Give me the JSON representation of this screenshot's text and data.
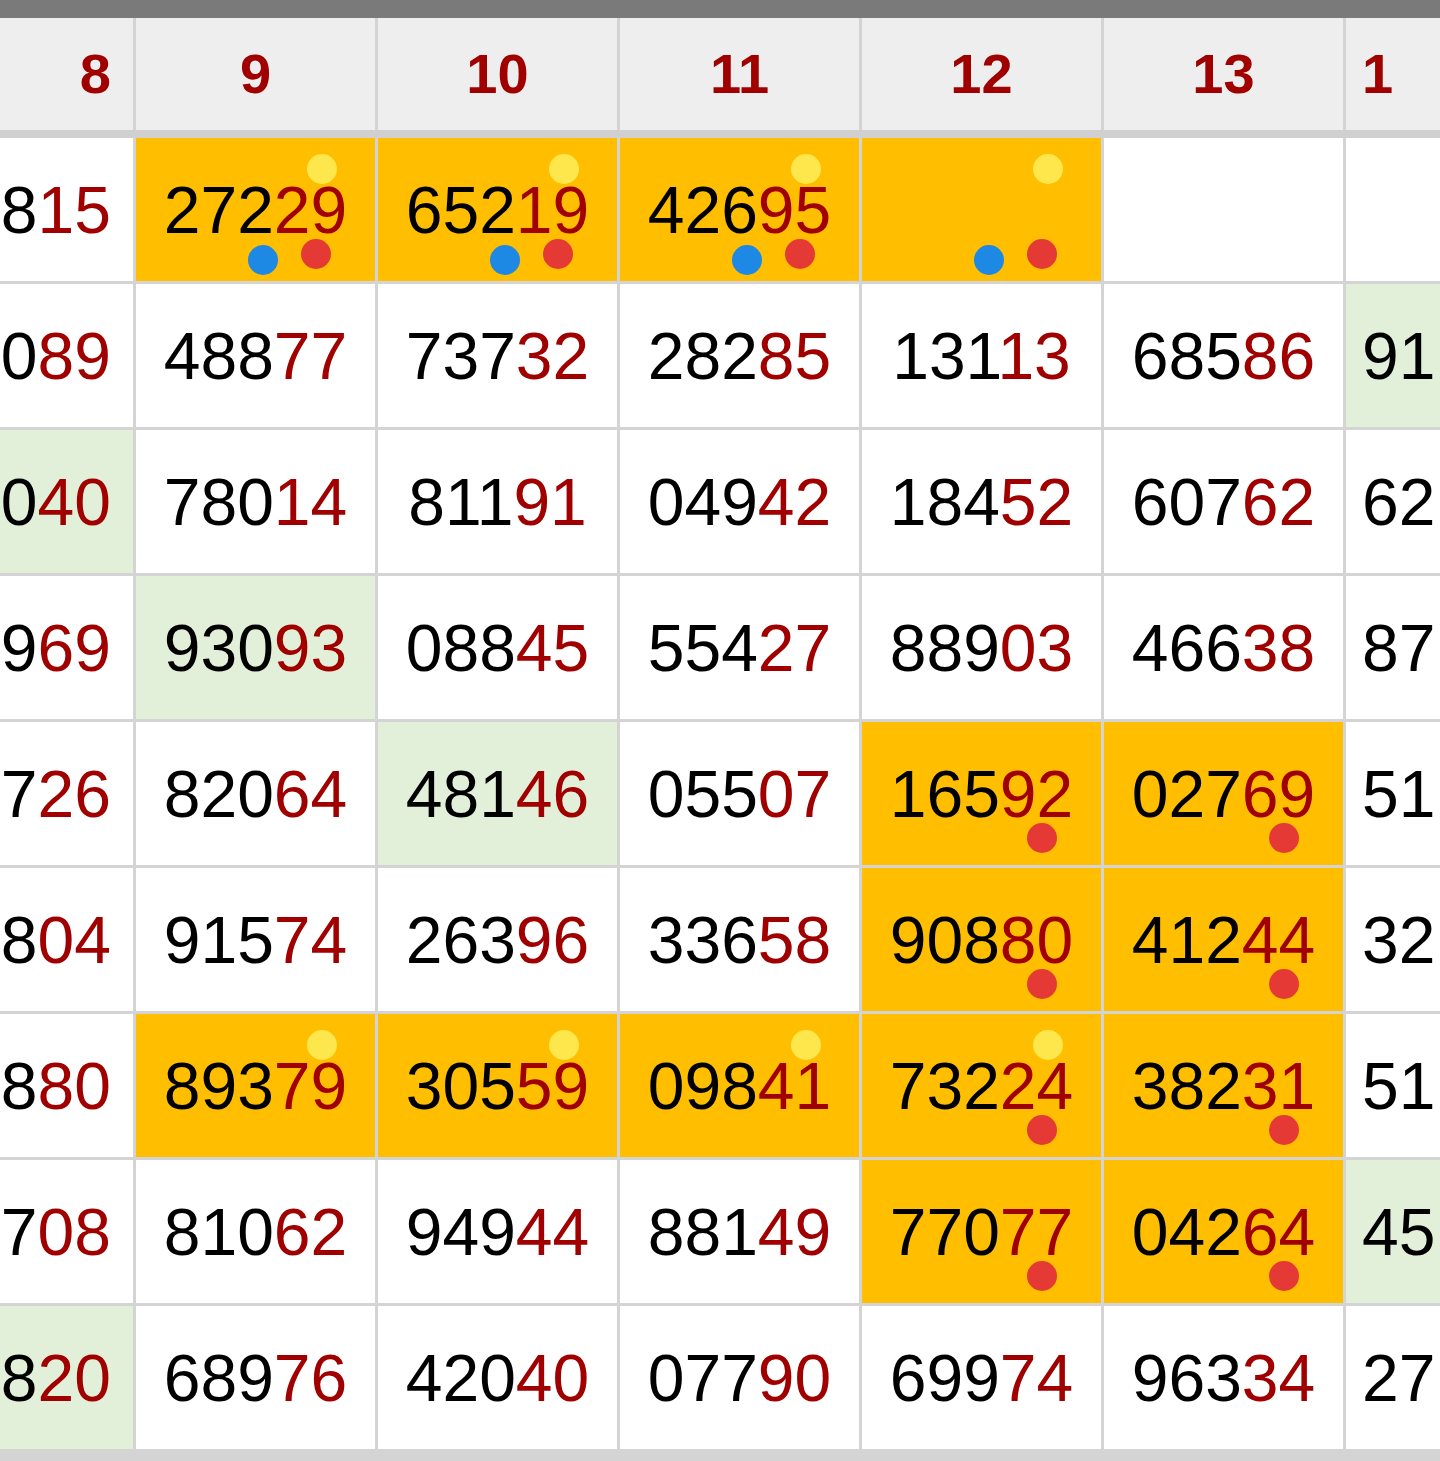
{
  "columns": [
    {
      "label": "8"
    },
    {
      "label": "9"
    },
    {
      "label": "10"
    },
    {
      "label": "11"
    },
    {
      "label": "12"
    },
    {
      "label": "13"
    },
    {
      "label": "1"
    }
  ],
  "rows": [
    {
      "cells": [
        {
          "lead": "8",
          "tail": "15",
          "color": "#ffffff"
        },
        {
          "lead": "272",
          "tail": "29",
          "color": "#ffbf00",
          "dots": [
            {
              "kind": "top",
              "color": "#fde74c"
            },
            {
              "kind": "left",
              "color": "#1e88e5"
            },
            {
              "kind": "right",
              "color": "#e53935"
            }
          ]
        },
        {
          "lead": "652",
          "tail": "19",
          "color": "#ffbf00",
          "dots": [
            {
              "kind": "top",
              "color": "#fde74c"
            },
            {
              "kind": "left",
              "color": "#1e88e5"
            },
            {
              "kind": "right",
              "color": "#e53935"
            }
          ]
        },
        {
          "lead": "426",
          "tail": "95",
          "color": "#ffbf00",
          "dots": [
            {
              "kind": "top",
              "color": "#fde74c"
            },
            {
              "kind": "left",
              "color": "#1e88e5"
            },
            {
              "kind": "right",
              "color": "#e53935"
            }
          ]
        },
        {
          "color": "#ffbf00",
          "dots": [
            {
              "kind": "top",
              "color": "#fde74c"
            },
            {
              "kind": "left",
              "color": "#1e88e5"
            },
            {
              "kind": "right",
              "color": "#e53935"
            }
          ]
        },
        {
          "color": "#ffffff"
        },
        {
          "color": "#ffffff"
        }
      ]
    },
    {
      "cells": [
        {
          "lead": "0",
          "tail": "89",
          "color": "#ffffff"
        },
        {
          "lead": "488",
          "tail": "77",
          "color": "#ffffff"
        },
        {
          "lead": "737",
          "tail": "32",
          "color": "#ffffff"
        },
        {
          "lead": "282",
          "tail": "85",
          "color": "#ffffff"
        },
        {
          "lead": "131",
          "tail": "13",
          "color": "#ffffff"
        },
        {
          "lead": "685",
          "tail": "86",
          "color": "#ffffff"
        },
        {
          "lead": "91",
          "color": "#e2f0da"
        }
      ]
    },
    {
      "cells": [
        {
          "lead": "0",
          "tail": "40",
          "color": "#e2f0da"
        },
        {
          "lead": "780",
          "tail": "14",
          "color": "#ffffff"
        },
        {
          "lead": "811",
          "tail": "91",
          "color": "#ffffff"
        },
        {
          "lead": "049",
          "tail": "42",
          "color": "#ffffff"
        },
        {
          "lead": "184",
          "tail": "52",
          "color": "#ffffff"
        },
        {
          "lead": "607",
          "tail": "62",
          "color": "#ffffff"
        },
        {
          "lead": "62",
          "color": "#ffffff"
        }
      ]
    },
    {
      "cells": [
        {
          "lead": "9",
          "tail": "69",
          "color": "#ffffff"
        },
        {
          "lead": "930",
          "tail": "93",
          "color": "#e2f0da"
        },
        {
          "lead": "088",
          "tail": "45",
          "color": "#ffffff"
        },
        {
          "lead": "554",
          "tail": "27",
          "color": "#ffffff"
        },
        {
          "lead": "889",
          "tail": "03",
          "color": "#ffffff"
        },
        {
          "lead": "466",
          "tail": "38",
          "color": "#ffffff"
        },
        {
          "lead": "87",
          "color": "#ffffff"
        }
      ]
    },
    {
      "cells": [
        {
          "lead": "7",
          "tail": "26",
          "color": "#ffffff"
        },
        {
          "lead": "820",
          "tail": "64",
          "color": "#ffffff"
        },
        {
          "lead": "481",
          "tail": "46",
          "color": "#e2f0da"
        },
        {
          "lead": "055",
          "tail": "07",
          "color": "#ffffff"
        },
        {
          "lead": "165",
          "tail": "92",
          "color": "#ffbf00",
          "dots": [
            {
              "kind": "right",
              "color": "#e53935"
            }
          ]
        },
        {
          "lead": "027",
          "tail": "69",
          "color": "#ffbf00",
          "dots": [
            {
              "kind": "right",
              "color": "#e53935"
            }
          ]
        },
        {
          "lead": "51",
          "color": "#ffffff"
        }
      ]
    },
    {
      "cells": [
        {
          "lead": "8",
          "tail": "04",
          "color": "#ffffff"
        },
        {
          "lead": "915",
          "tail": "74",
          "color": "#ffffff"
        },
        {
          "lead": "263",
          "tail": "96",
          "color": "#ffffff"
        },
        {
          "lead": "336",
          "tail": "58",
          "color": "#ffffff"
        },
        {
          "lead": "908",
          "tail": "80",
          "color": "#ffbf00",
          "dots": [
            {
              "kind": "right",
              "color": "#e53935"
            }
          ]
        },
        {
          "lead": "412",
          "tail": "44",
          "color": "#ffbf00",
          "dots": [
            {
              "kind": "right",
              "color": "#e53935"
            }
          ]
        },
        {
          "lead": "32",
          "color": "#ffffff"
        }
      ]
    },
    {
      "cells": [
        {
          "lead": "8",
          "tail": "80",
          "color": "#ffffff"
        },
        {
          "lead": "893",
          "tail": "79",
          "color": "#ffbf00",
          "dots": [
            {
              "kind": "top",
              "color": "#fde74c"
            }
          ]
        },
        {
          "lead": "305",
          "tail": "59",
          "color": "#ffbf00",
          "dots": [
            {
              "kind": "top",
              "color": "#fde74c"
            }
          ]
        },
        {
          "lead": "098",
          "tail": "41",
          "color": "#ffbf00",
          "dots": [
            {
              "kind": "top",
              "color": "#fde74c"
            }
          ]
        },
        {
          "lead": "732",
          "tail": "24",
          "color": "#ffbf00",
          "dots": [
            {
              "kind": "top",
              "color": "#fde74c"
            },
            {
              "kind": "right",
              "color": "#e53935"
            }
          ]
        },
        {
          "lead": "382",
          "tail": "31",
          "color": "#ffbf00",
          "dots": [
            {
              "kind": "right",
              "color": "#e53935"
            }
          ]
        },
        {
          "lead": "51",
          "color": "#ffffff"
        }
      ]
    },
    {
      "cells": [
        {
          "lead": "7",
          "tail": "08",
          "color": "#ffffff"
        },
        {
          "lead": "810",
          "tail": "62",
          "color": "#ffffff"
        },
        {
          "lead": "949",
          "tail": "44",
          "color": "#ffffff"
        },
        {
          "lead": "881",
          "tail": "49",
          "color": "#ffffff"
        },
        {
          "lead": "770",
          "tail": "77",
          "color": "#ffbf00",
          "dots": [
            {
              "kind": "right",
              "color": "#e53935"
            }
          ]
        },
        {
          "lead": "042",
          "tail": "64",
          "color": "#ffbf00",
          "dots": [
            {
              "kind": "right",
              "color": "#e53935"
            }
          ]
        },
        {
          "lead": "45",
          "color": "#e2f0da"
        }
      ]
    },
    {
      "cells": [
        {
          "lead": "8",
          "tail": "20",
          "color": "#e2f0da"
        },
        {
          "lead": "689",
          "tail": "76",
          "color": "#ffffff"
        },
        {
          "lead": "420",
          "tail": "40",
          "color": "#ffffff"
        },
        {
          "lead": "077",
          "tail": "90",
          "color": "#ffffff"
        },
        {
          "lead": "699",
          "tail": "74",
          "color": "#ffffff"
        },
        {
          "lead": "963",
          "tail": "34",
          "color": "#ffffff"
        },
        {
          "lead": "27",
          "color": "#ffffff"
        }
      ]
    }
  ]
}
